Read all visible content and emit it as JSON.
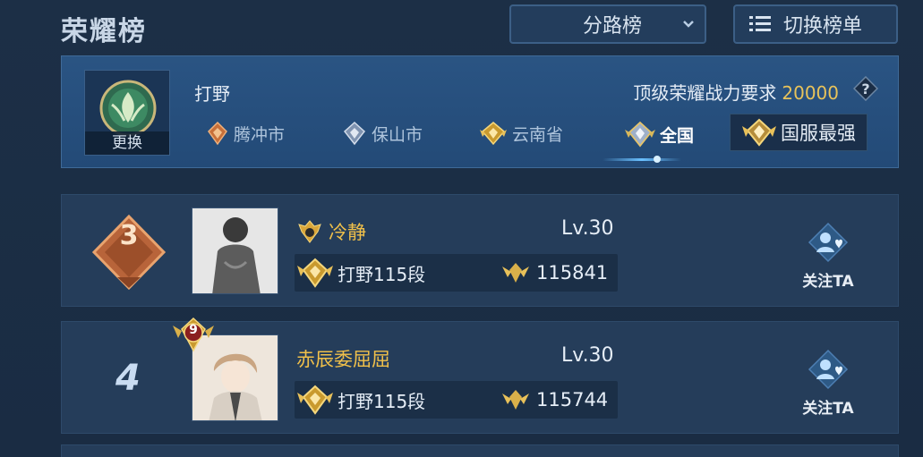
{
  "header": {
    "title": "荣耀榜",
    "dropdown_label": "分路榜",
    "switch_label": "切换榜单"
  },
  "filter": {
    "change_label": "更换",
    "role": "打野",
    "requirement_label": "顶级荣耀战力要求",
    "requirement_value": "20000",
    "regions": [
      {
        "label": "腾冲市"
      },
      {
        "label": "保山市"
      },
      {
        "label": "云南省"
      },
      {
        "label": "全国"
      },
      {
        "label": "国服最强"
      }
    ]
  },
  "rows": [
    {
      "rank": "3",
      "name": "冷静",
      "level": "Lv.30",
      "rank_tier": "打野115段",
      "power": "115841",
      "follow_label": "关注TA"
    },
    {
      "rank": "4",
      "level_badge": "9",
      "name": "赤辰委屈屈",
      "level": "Lv.30",
      "rank_tier": "打野115段",
      "power": "115744",
      "follow_label": "关注TA"
    }
  ],
  "colors": {
    "accent_gold": "#f0c04a",
    "panel_blue": "#234a77",
    "background": "#1c2f46"
  }
}
